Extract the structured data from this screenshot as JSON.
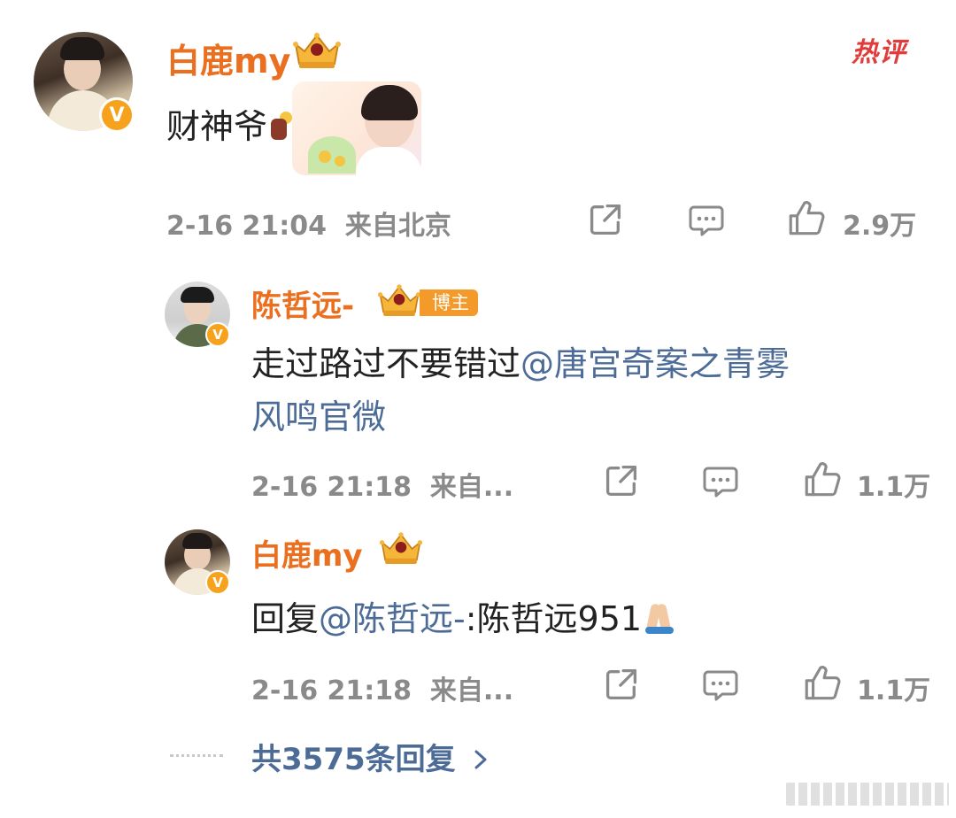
{
  "hot_tag": "热评",
  "comment": {
    "author": "白鹿my",
    "level": "9",
    "text": "财神爷",
    "time": "2-16 21:04",
    "location": "来自北京",
    "likes": "2.9万"
  },
  "replies": [
    {
      "author": "陈哲远-",
      "level": "9",
      "badge": "博主",
      "text_line1_plain": "走过路过不要错过",
      "text_line1_mention": "@唐宫奇案之青雾",
      "text_line2_mention": "风鸣官微",
      "time": "2-16 21:18",
      "location": "来自...",
      "likes": "1.1万"
    },
    {
      "author": "白鹿my",
      "level": "9",
      "text_prefix": "回复",
      "text_mention": "@陈哲远-",
      "text_suffix": ":陈哲远951",
      "time": "2-16 21:18",
      "location": "来自...",
      "likes": "1.1万"
    }
  ],
  "more_replies": "共3575条回复",
  "colors": {
    "name": "#ea6f1f",
    "link": "#4c6c97",
    "meta": "#8a8a8a",
    "vip": "#f7a21c"
  },
  "icons": [
    "share-icon",
    "comment-icon",
    "like-icon",
    "chevron-right-icon",
    "prayer-hands-icon",
    "god-of-wealth-emoji-icon",
    "crown-level-icon",
    "verified-v-icon"
  ]
}
